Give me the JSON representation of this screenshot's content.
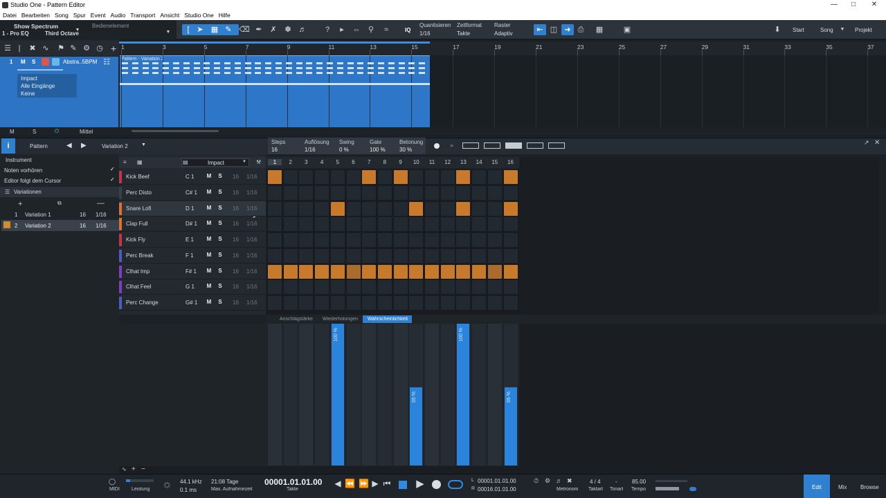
{
  "window": {
    "title": "Studio One - Pattern Editor"
  },
  "menu": [
    "Datei",
    "Bearbeiten",
    "Song",
    "Spur",
    "Event",
    "Audio",
    "Transport",
    "Ansicht",
    "Studio One",
    "Hilfe"
  ],
  "toolbar": {
    "show_spectrum": "Show Spectrum",
    "bedienelement": "Bedienelement",
    "preset": "1 - Pro EQ",
    "octave": "Third Octave",
    "quantize_label": "Quantisieren",
    "quantize_value": "1/16",
    "timeformat_label": "Zeitformat",
    "timeformat_value": "Takte",
    "raster_label": "Raster",
    "raster_value": "Adaptiv",
    "iq": "IQ",
    "start": "Start",
    "song": "Song",
    "projekt": "Projekt"
  },
  "track": {
    "number": "1",
    "m": "M",
    "s": "S",
    "name": "Abstra..5BPM",
    "instrument": "Impact",
    "input": "Alle Eingänge",
    "output": "Keine",
    "bottom_m": "M",
    "bottom_s": "S",
    "mid": "Mittel"
  },
  "ruler": [
    "1",
    "3",
    "5",
    "7",
    "9",
    "11",
    "13",
    "15",
    "17",
    "19",
    "21",
    "23",
    "25",
    "27",
    "29",
    "31",
    "33",
    "35",
    "37"
  ],
  "clip": {
    "label": "Pattern - Variation 2"
  },
  "editor": {
    "pattern_label": "Pattern",
    "variation_name": "Variation 2",
    "steps_label": "Steps",
    "steps_value": "16",
    "res_label": "Auflösung",
    "res_value": "1/16",
    "swing_label": "Swing",
    "swing_value": "0 %",
    "gate_label": "Gate",
    "gate_value": "100 %",
    "accent_label": "Betonung",
    "accent_value": "30 %"
  },
  "left_panel": {
    "instrument": "Instrument",
    "preview": "Noten vorhören",
    "follow": "Editor folgt dem Cursor",
    "variations_header": "Variationen",
    "variations": [
      {
        "num": "1",
        "name": "Variation 1",
        "steps": "16",
        "res": "1/16"
      },
      {
        "num": "2",
        "name": "Variation 2",
        "steps": "16",
        "res": "1/16"
      }
    ]
  },
  "instrument_header": {
    "name": "Impact"
  },
  "step_numbers": [
    "1",
    "2",
    "3",
    "4",
    "5",
    "6",
    "7",
    "8",
    "9",
    "10",
    "11",
    "12",
    "13",
    "14",
    "15",
    "16"
  ],
  "instruments": [
    {
      "name": "Kick Beef",
      "note": "C 1",
      "color": "#c7334c",
      "steps": [
        1,
        0,
        0,
        0,
        0,
        0,
        1,
        0,
        1,
        0,
        0,
        0,
        1,
        0,
        0,
        1
      ]
    },
    {
      "name": "Perc Disto",
      "note": "C# 1",
      "color": "#3b3f46",
      "steps": [
        0,
        0,
        0,
        0,
        0,
        0,
        0,
        0,
        0,
        0,
        0,
        0,
        0,
        0,
        0,
        0
      ]
    },
    {
      "name": "Snare Lofi",
      "note": "D 1",
      "color": "#e0702e",
      "steps": [
        0,
        0,
        0,
        0,
        1,
        0,
        0,
        0,
        0,
        1,
        0,
        0,
        1,
        0,
        0,
        1
      ]
    },
    {
      "name": "Clap Full",
      "note": "D# 1",
      "color": "#e0702e",
      "steps": [
        0,
        0,
        0,
        0,
        0,
        0,
        0,
        0,
        0,
        0,
        0,
        0,
        0,
        0,
        0,
        0
      ]
    },
    {
      "name": "Kick Fly",
      "note": "E 1",
      "color": "#c7334c",
      "steps": [
        0,
        0,
        0,
        0,
        0,
        0,
        0,
        0,
        0,
        0,
        0,
        0,
        0,
        0,
        0,
        0
      ]
    },
    {
      "name": "Perc Break",
      "note": "F 1",
      "color": "#4b5cc4",
      "steps": [
        0,
        0,
        0,
        0,
        0,
        0,
        0,
        0,
        0,
        0,
        0,
        0,
        0,
        0,
        0,
        0
      ]
    },
    {
      "name": "Clhat Imp",
      "note": "F# 1",
      "color": "#7b3fc0",
      "steps": [
        1,
        1,
        1,
        1,
        1,
        2,
        1,
        1,
        1,
        1,
        1,
        1,
        1,
        1,
        2,
        1
      ]
    },
    {
      "name": "Clhat Feel",
      "note": "G 1",
      "color": "#7b3fc0",
      "steps": [
        0,
        0,
        0,
        0,
        0,
        0,
        0,
        0,
        0,
        0,
        0,
        0,
        0,
        0,
        0,
        0
      ]
    },
    {
      "name": "Perc Change",
      "note": "G# 1",
      "color": "#4b5cc4",
      "steps": [
        0,
        0,
        0,
        0,
        0,
        0,
        0,
        0,
        0,
        0,
        0,
        0,
        0,
        0,
        0,
        0
      ]
    }
  ],
  "instrument_common": {
    "m": "M",
    "s": "S",
    "steps": "16",
    "res": "1/16"
  },
  "lane_tabs": [
    "Anschlagstärke",
    "Wiederholungen",
    "Wahrscheinlichkeit"
  ],
  "probability": [
    {
      "step": 5,
      "value": 100,
      "label": "100 %"
    },
    {
      "step": 10,
      "value": 55,
      "label": "55 %"
    },
    {
      "step": 13,
      "value": 100,
      "label": "100 %"
    },
    {
      "step": 16,
      "value": 55,
      "label": "55 %"
    }
  ],
  "transport": {
    "midi": "MIDI",
    "leistung": "Leistung",
    "sample_rate": "44.1 kHz",
    "latency": "0.1 ms",
    "rec_time": "21:08 Tage",
    "rec_label": "Max. Aufnahmezeit",
    "position": "00001.01.01.00",
    "position_label": "Takte",
    "loop_l_label": "L",
    "loop_l": "00001.01.01.00",
    "loop_r_label": "R",
    "loop_r": "00016.01.01.00",
    "metronome": "Metronom",
    "timesig": "4 / 4",
    "timesig_label": "Taktart",
    "key": "-",
    "key_label": "Tonart",
    "tempo": "85.00",
    "tempo_label": "Tempo",
    "edit": "Edit",
    "mix": "Mix",
    "browse": "Browse"
  }
}
